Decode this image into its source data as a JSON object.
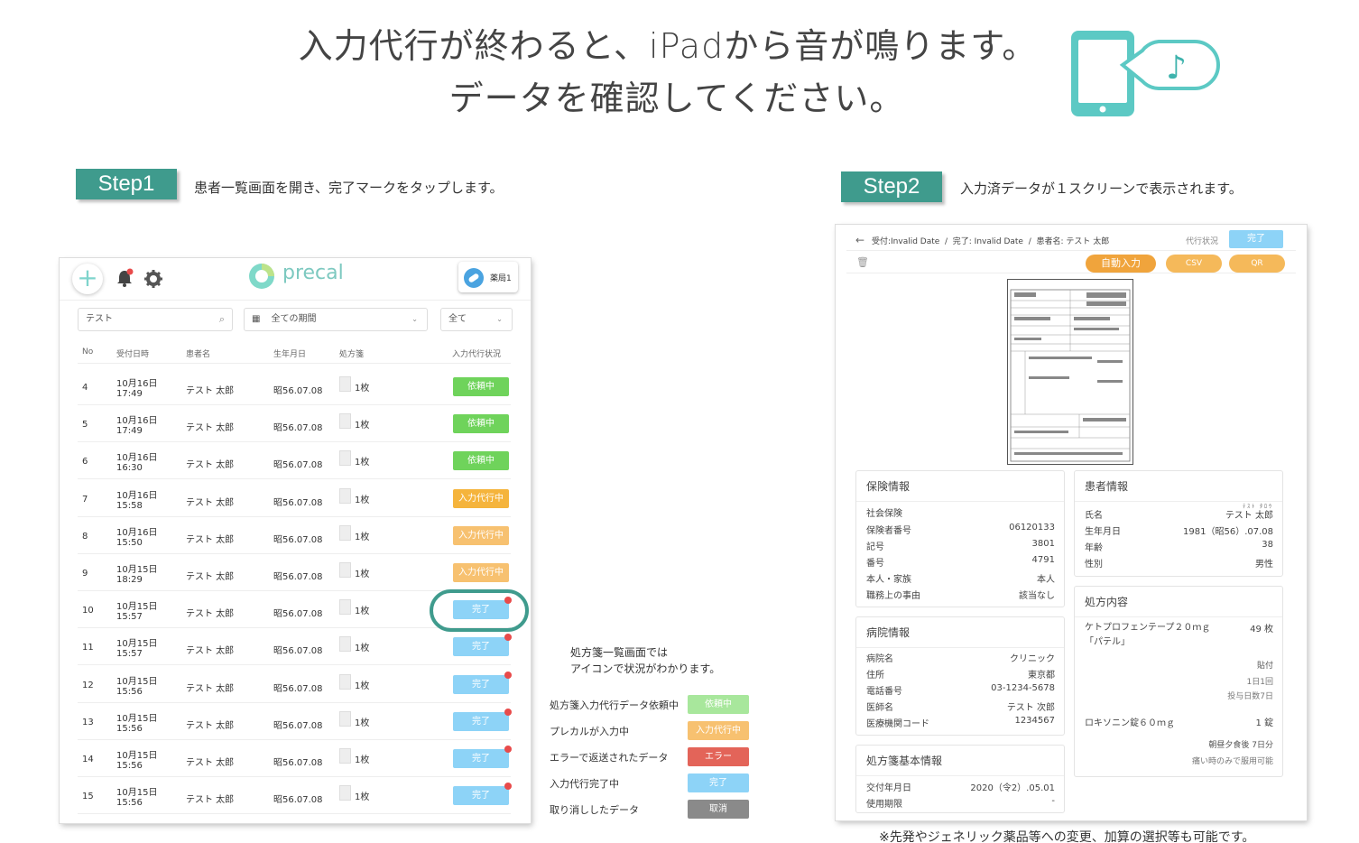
{
  "headline": {
    "line1": "入力代行が終わると、iPadから音が鳴ります。",
    "line2": "データを確認してください。"
  },
  "step1": {
    "badge": "Step1",
    "description": "患者一覧画面を開き、完了マークをタップします。"
  },
  "step2": {
    "badge": "Step2",
    "description": "入力済データが１スクリーンで表示されます。"
  },
  "app": {
    "logo": "precal",
    "user": "薬局1",
    "search_value": "テスト",
    "period_select": "全ての期間",
    "status_select": "全て",
    "columns": [
      "No",
      "受付日時",
      "患者名",
      "生年月日",
      "処方箋",
      "入力代行状況"
    ],
    "rows": [
      {
        "no": "4",
        "date": "10月16日",
        "time": "17:49",
        "name": "テスト 太郎",
        "birth": "昭56.07.08",
        "rx": "1枚",
        "status": "依頼中",
        "cls": "st-req",
        "dot": false
      },
      {
        "no": "5",
        "date": "10月16日",
        "time": "17:49",
        "name": "テスト 太郎",
        "birth": "昭56.07.08",
        "rx": "1枚",
        "status": "依頼中",
        "cls": "st-req",
        "dot": false
      },
      {
        "no": "6",
        "date": "10月16日",
        "time": "16:30",
        "name": "テスト 太郎",
        "birth": "昭56.07.08",
        "rx": "1枚",
        "status": "依頼中",
        "cls": "st-req",
        "dot": false
      },
      {
        "no": "7",
        "date": "10月16日",
        "time": "15:58",
        "name": "テスト 太郎",
        "birth": "昭56.07.08",
        "rx": "1枚",
        "status": "入力代行中",
        "cls": "st-prog",
        "dot": false
      },
      {
        "no": "8",
        "date": "10月16日",
        "time": "15:50",
        "name": "テスト 太郎",
        "birth": "昭56.07.08",
        "rx": "1枚",
        "status": "入力代行中",
        "cls": "st-prog2",
        "dot": false
      },
      {
        "no": "9",
        "date": "10月15日",
        "time": "18:29",
        "name": "テスト 太郎",
        "birth": "昭56.07.08",
        "rx": "1枚",
        "status": "入力代行中",
        "cls": "st-prog2",
        "dot": false
      },
      {
        "no": "10",
        "date": "10月15日",
        "time": "15:57",
        "name": "テスト 太郎",
        "birth": "昭56.07.08",
        "rx": "1枚",
        "status": "完了",
        "cls": "st-done",
        "dot": true
      },
      {
        "no": "11",
        "date": "10月15日",
        "time": "15:57",
        "name": "テスト 太郎",
        "birth": "昭56.07.08",
        "rx": "1枚",
        "status": "完了",
        "cls": "st-done",
        "dot": true
      },
      {
        "no": "12",
        "date": "10月15日",
        "time": "15:56",
        "name": "テスト 太郎",
        "birth": "昭56.07.08",
        "rx": "1枚",
        "status": "完了",
        "cls": "st-done",
        "dot": true
      },
      {
        "no": "13",
        "date": "10月15日",
        "time": "15:56",
        "name": "テスト 太郎",
        "birth": "昭56.07.08",
        "rx": "1枚",
        "status": "完了",
        "cls": "st-done",
        "dot": true
      },
      {
        "no": "14",
        "date": "10月15日",
        "time": "15:56",
        "name": "テスト 太郎",
        "birth": "昭56.07.08",
        "rx": "1枚",
        "status": "完了",
        "cls": "st-done",
        "dot": true
      },
      {
        "no": "15",
        "date": "10月15日",
        "time": "15:56",
        "name": "テスト 太郎",
        "birth": "昭56.07.08",
        "rx": "1枚",
        "status": "完了",
        "cls": "st-done",
        "dot": true
      }
    ]
  },
  "legend": {
    "note_line1": "処方箋一覧画面では",
    "note_line2": "アイコンで状況がわかります。",
    "items": [
      {
        "label": "処方箋入力代行データ依頼中",
        "badge": "依頼中",
        "cls": "st-req-l"
      },
      {
        "label": "プレカルが入力中",
        "badge": "入力代行中",
        "cls": "st-prog2"
      },
      {
        "label": "エラーで返送されたデータ",
        "badge": "エラー",
        "cls": "st-err"
      },
      {
        "label": "入力代行完了中",
        "badge": "完了",
        "cls": "st-done"
      },
      {
        "label": "取り消ししたデータ",
        "badge": "取消",
        "cls": "st-cancel"
      }
    ]
  },
  "detail": {
    "breadcrumb": "受付:Invalid Date  /  完了: Invalid Date  /  患者名: テスト 太郎",
    "status_label": "代行状況",
    "status_value": "完了",
    "btn_auto": "自動入力",
    "btn_csv": "CSV",
    "btn_qr": "QR",
    "insurance": {
      "title": "保険情報",
      "type": "社会保険",
      "rows": [
        {
          "k": "保険者番号",
          "v": "06120133"
        },
        {
          "k": "記号",
          "v": "3801"
        },
        {
          "k": "番号",
          "v": "4791"
        },
        {
          "k": "本人・家族",
          "v": "本人"
        },
        {
          "k": "職務上の事由",
          "v": "該当なし"
        }
      ]
    },
    "patient": {
      "title": "患者情報",
      "kana": "ﾃｽﾄ ﾀﾛｳ",
      "rows": [
        {
          "k": "氏名",
          "v": "テスト 太郎"
        },
        {
          "k": "生年月日",
          "v": "1981（昭56）.07.08"
        },
        {
          "k": "年齢",
          "v": "38"
        },
        {
          "k": "性別",
          "v": "男性"
        }
      ]
    },
    "hospital": {
      "title": "病院情報",
      "rows": [
        {
          "k": "病院名",
          "v": "クリニック"
        },
        {
          "k": "住所",
          "v": "東京都"
        },
        {
          "k": "電話番号",
          "v": "03-1234-5678"
        },
        {
          "k": "医師名",
          "v": "テスト 次郎"
        },
        {
          "k": "医療機関コード",
          "v": "1234567"
        }
      ]
    },
    "rx": {
      "title": "処方内容",
      "drug1": "ケトプロフェンテープ２０ｍｇ「パテル」",
      "drug1_qty": "49 枚",
      "drug1_use": "貼付",
      "drug1_freq": "1日1回",
      "drug1_days": "投与日数7日",
      "drug2": "ロキソニン錠６０ｍｇ",
      "drug2_qty": "1 錠",
      "drug2_use": "朝昼夕食後 7日分",
      "drug2_note": "痛い時のみで服用可能"
    },
    "basic": {
      "title": "処方箋基本情報",
      "rows": [
        {
          "k": "交付年月日",
          "v": "2020（令2）.05.01"
        },
        {
          "k": "使用期限",
          "v": "-"
        }
      ]
    }
  },
  "footnote": "※先発やジェネリック薬品等への変更、加算の選択等も可能です。"
}
